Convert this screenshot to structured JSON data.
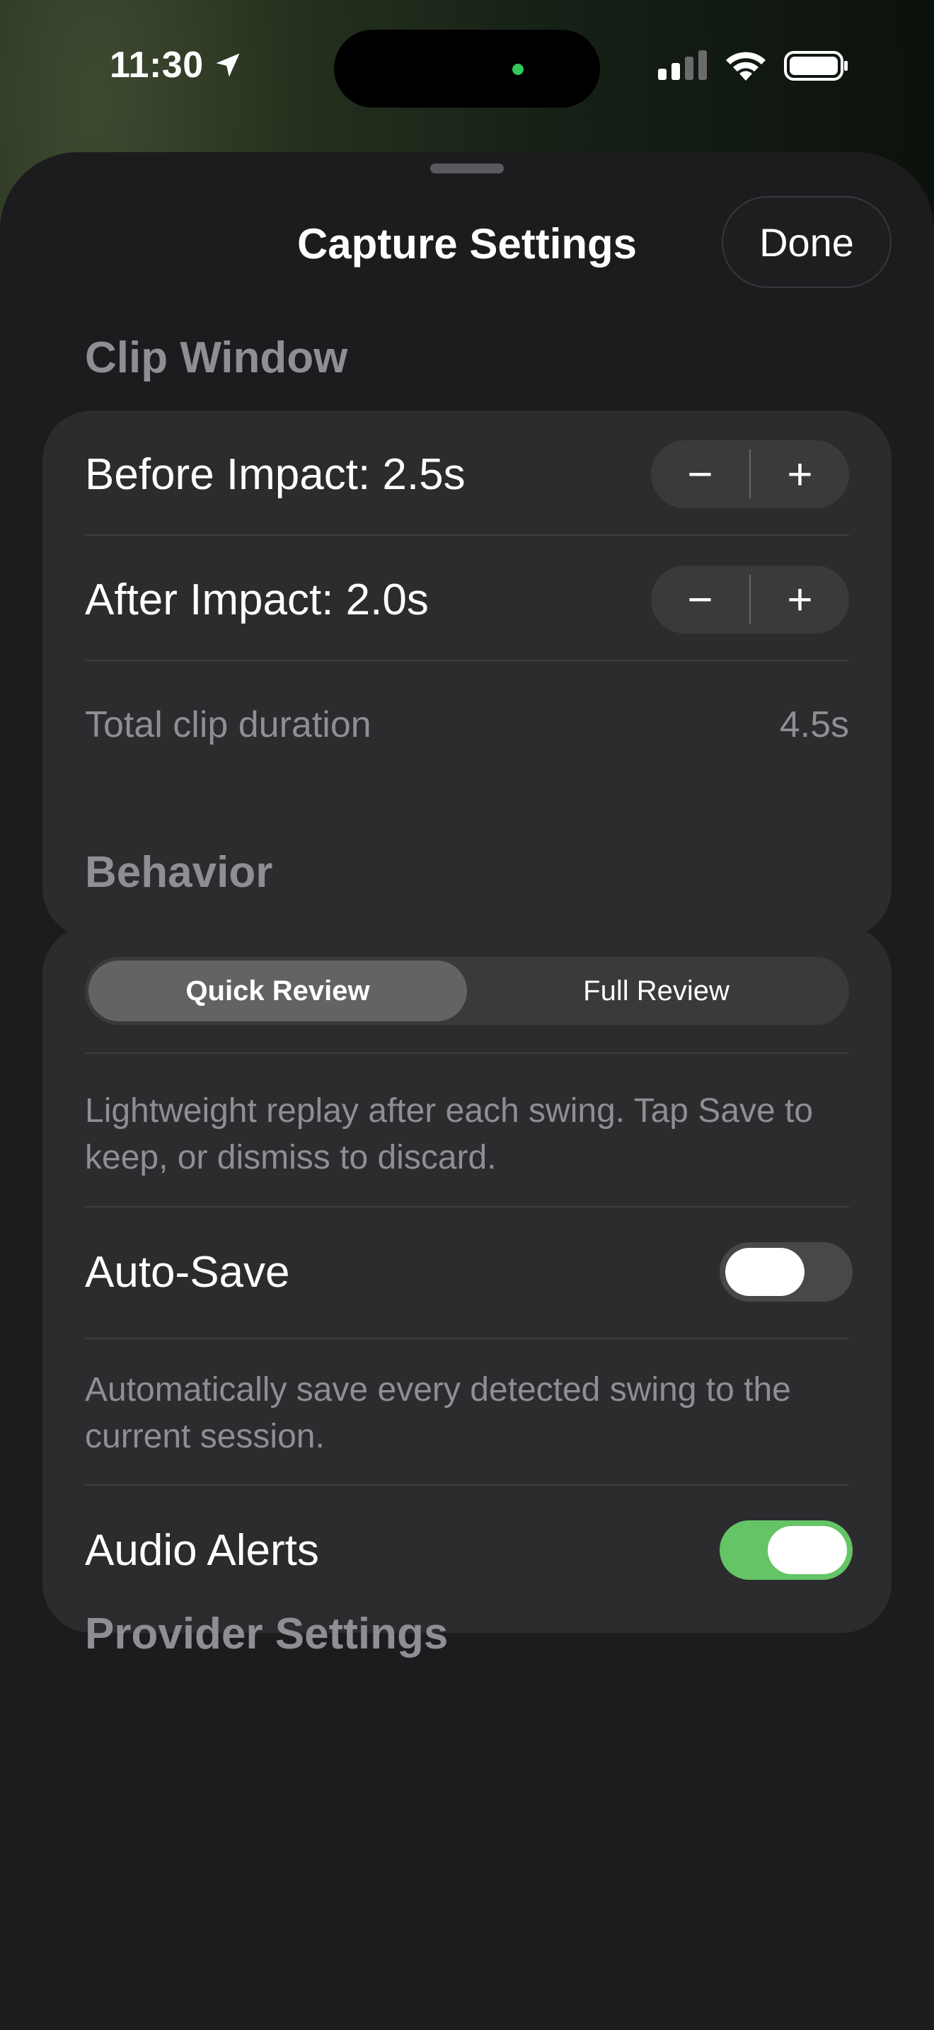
{
  "status_bar": {
    "time": "11:30"
  },
  "sheet": {
    "title": "Capture Settings",
    "done_label": "Done"
  },
  "clip_window": {
    "header": "Clip Window",
    "before": {
      "label": "Before Impact: 2.5s",
      "minus": "−",
      "plus": "+"
    },
    "after": {
      "label": "After Impact: 2.0s",
      "minus": "−",
      "plus": "+"
    },
    "total_label": "Total clip duration",
    "total_value": "4.5s"
  },
  "behavior": {
    "header": "Behavior",
    "review_options": [
      "Quick Review",
      "Full Review"
    ],
    "selected_review": "Quick Review",
    "review_description": "Lightweight replay after each swing. Tap Save to keep, or dismiss to discard.",
    "auto_save": {
      "label": "Auto-Save",
      "on": false
    },
    "auto_save_description": "Automatically save every detected swing to the current session.",
    "audio_alerts": {
      "label": "Audio Alerts",
      "on": true
    }
  },
  "provider": {
    "header": "Provider Settings"
  },
  "colors": {
    "toggle_on": "#65c466",
    "toggle_off": "#48484a",
    "accent_dot": "#35c759"
  }
}
